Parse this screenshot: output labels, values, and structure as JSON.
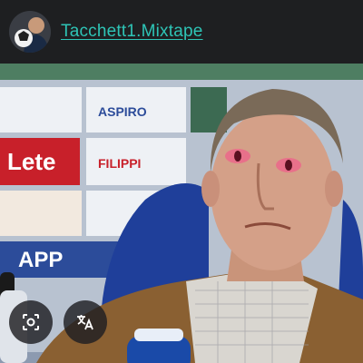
{
  "post_header": {
    "username": "Tacchett1.Mixtape",
    "avatar_icon": "profile-avatar"
  },
  "backdrop": {
    "sponsors": [
      "Lete",
      "ASPIRO",
      "FILIPPI",
      "APP"
    ],
    "accent_color": "#2ec4b6"
  },
  "floating_actions": [
    {
      "name": "lens-icon"
    },
    {
      "name": "translate-icon"
    }
  ]
}
